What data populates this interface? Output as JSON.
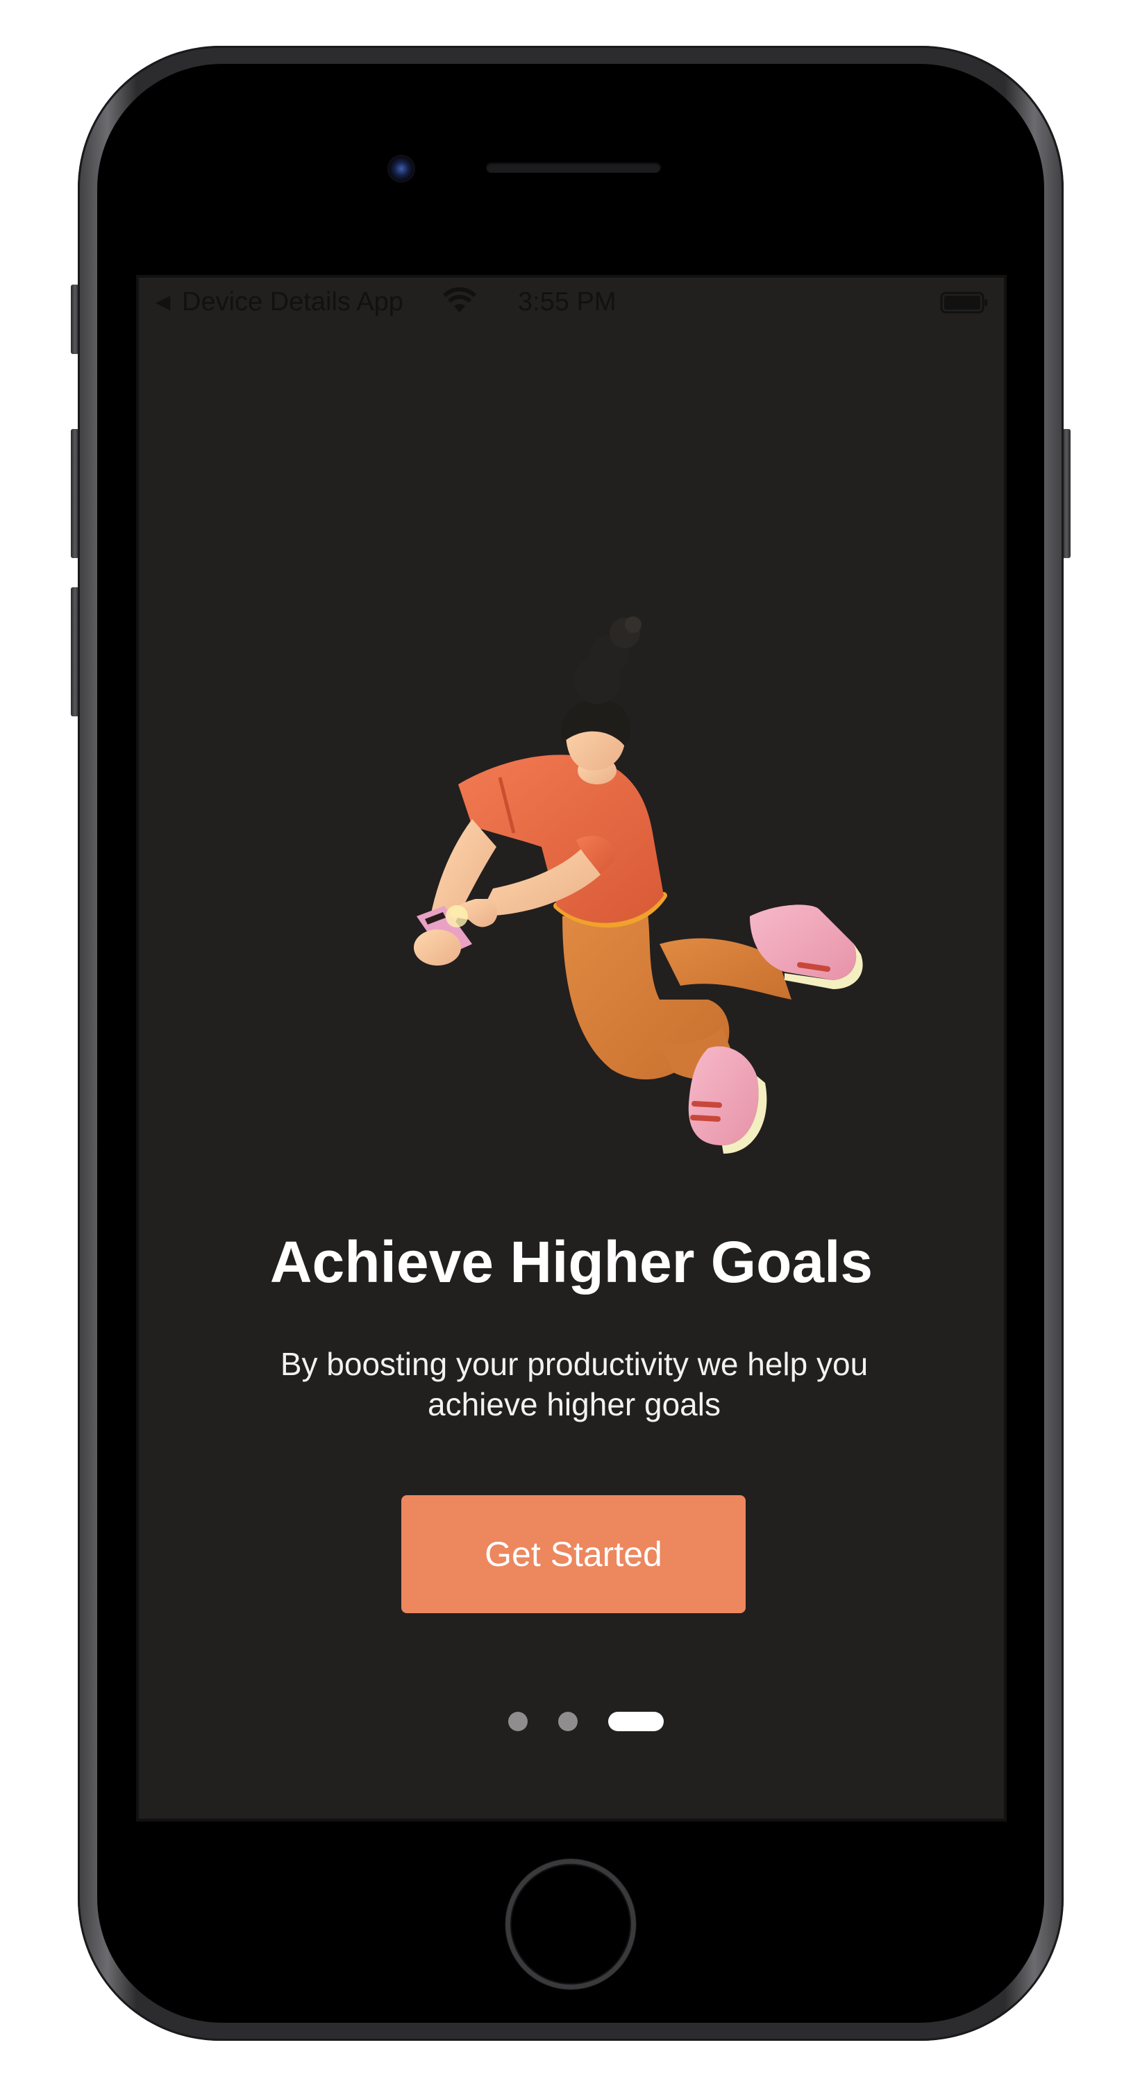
{
  "status_bar": {
    "back_glyph": "◀",
    "app_name": "Device Details App",
    "time": "3:55 PM",
    "wifi_icon": "wifi-icon",
    "battery_icon": "battery-icon"
  },
  "onboarding": {
    "title": "Achieve Higher Goals",
    "subtitle": "By boosting your productivity we help you achieve higher goals",
    "cta_label": "Get Started",
    "page_indicator": {
      "total": 3,
      "active_index": 2
    },
    "illustration": "person-with-phone-illustration"
  },
  "colors": {
    "background": "#221f1f",
    "accent": "#ec875e",
    "indicator_inactive": "#8f8d8d",
    "indicator_active": "#ffffff"
  }
}
